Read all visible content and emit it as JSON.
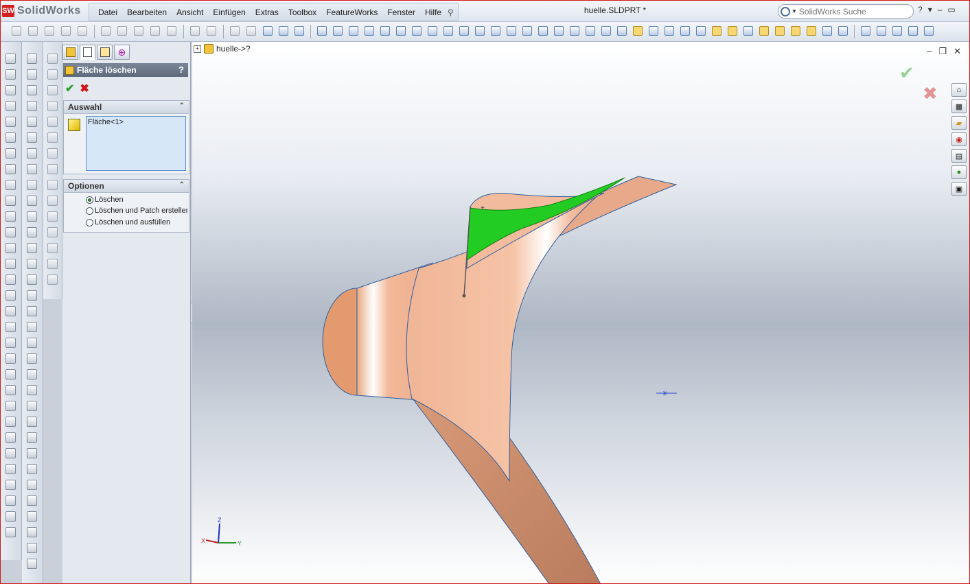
{
  "app": {
    "brand": "SolidWorks",
    "logo_mark": "SW",
    "doc_title": "huelle.SLDPRT *"
  },
  "menu": [
    "Datei",
    "Bearbeiten",
    "Ansicht",
    "Einfügen",
    "Extras",
    "Toolbox",
    "FeatureWorks",
    "Fenster",
    "Hilfe"
  ],
  "search": {
    "placeholder": "SolidWorks Suche"
  },
  "window_controls": {
    "help": "?",
    "dropdown": "▾",
    "minimize": "–",
    "restore": "▭"
  },
  "property_manager": {
    "title": "Fläche löschen",
    "help": "?",
    "ok": "✔",
    "cancel": "✖",
    "auswahl": {
      "title": "Auswahl",
      "selection": "Fläche<1>"
    },
    "optionen": {
      "title": "Optionen",
      "options": [
        "Löschen",
        "Löschen und Patch erstellen",
        "Löschen und ausfüllen"
      ],
      "selected_index": 0
    }
  },
  "viewport": {
    "tree_flyout": "huelle->?",
    "controls": {
      "minimize": "–",
      "restore": "❐",
      "close": "✕"
    },
    "confirm_ok": "✔",
    "confirm_cancel": "✖",
    "triad": {
      "x": "X",
      "y": "Y",
      "z": "Z"
    }
  },
  "colors": {
    "model": "#efb491",
    "selected_face": "#22cc22",
    "accent": "#2f5f9e"
  }
}
